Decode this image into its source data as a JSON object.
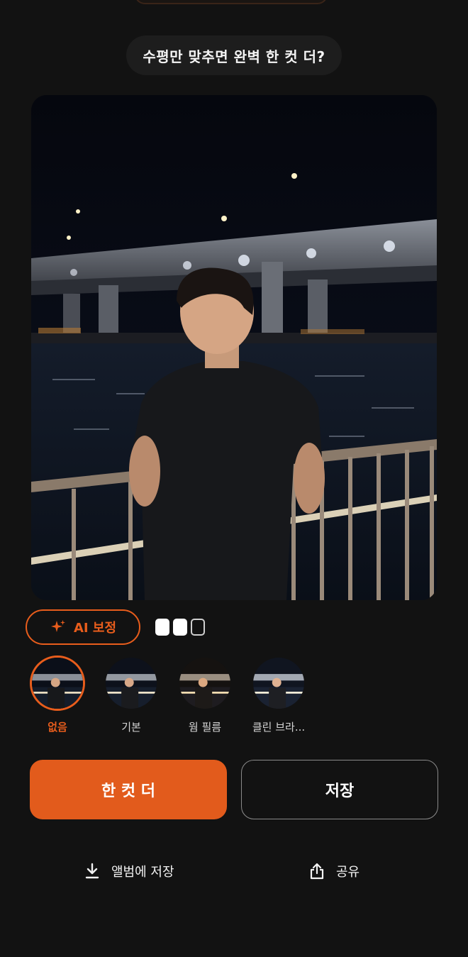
{
  "header": {
    "hint": "수평만 맞추면 완벽 한 컷 더?"
  },
  "photo": {
    "description_icon": "photo-preview"
  },
  "ai_button": {
    "label": "AI 보정",
    "icon": "sparkle-icon"
  },
  "progress": {
    "filled": 2,
    "total": 3
  },
  "filters": [
    {
      "label": "없음",
      "selected": true
    },
    {
      "label": "기본",
      "selected": false
    },
    {
      "label": "웜 필름",
      "selected": false
    },
    {
      "label": "클린 브라...",
      "selected": false
    }
  ],
  "buttons": {
    "primary": "한 컷 더",
    "secondary": "저장"
  },
  "actions": {
    "album": {
      "label": "앨범에 저장",
      "icon": "download-icon"
    },
    "share": {
      "label": "공유",
      "icon": "share-icon"
    }
  },
  "colors": {
    "accent": "#e85d1c",
    "background": "#121212"
  }
}
